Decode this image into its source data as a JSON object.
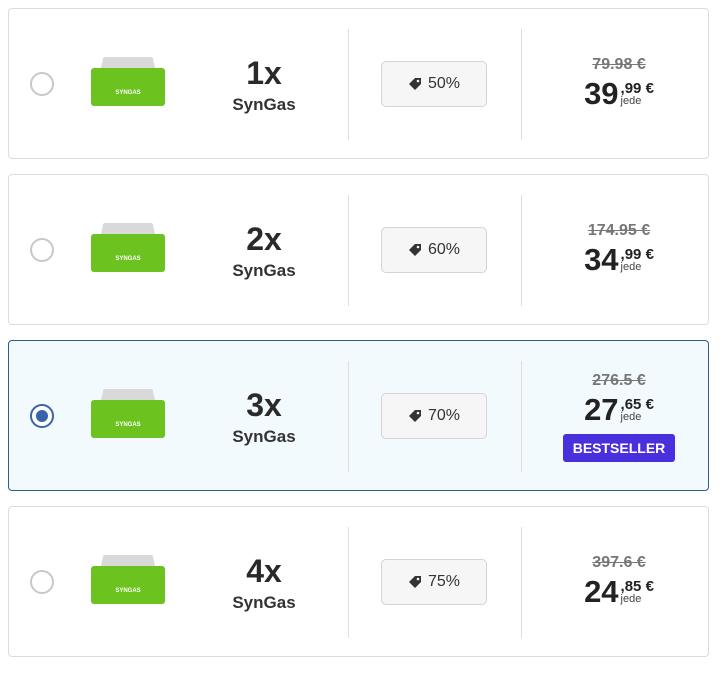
{
  "options": [
    {
      "quantity": "1x",
      "product": "SynGas",
      "device_label": "SYNGAS",
      "discount": "50%",
      "old_price": "79.98 €",
      "price_whole": "39",
      "price_fraction": ",99",
      "currency": "€",
      "per_unit": "jede",
      "badge": "",
      "selected": false
    },
    {
      "quantity": "2x",
      "product": "SynGas",
      "device_label": "SYNGAS",
      "discount": "60%",
      "old_price": "174.95 €",
      "price_whole": "34",
      "price_fraction": ",99",
      "currency": "€",
      "per_unit": "jede",
      "badge": "",
      "selected": false
    },
    {
      "quantity": "3x",
      "product": "SynGas",
      "device_label": "SYNGAS",
      "discount": "70%",
      "old_price": "276.5 €",
      "price_whole": "27",
      "price_fraction": ",65",
      "currency": "€",
      "per_unit": "jede",
      "badge": "BESTSELLER",
      "selected": true
    },
    {
      "quantity": "4x",
      "product": "SynGas",
      "device_label": "SYNGAS",
      "discount": "75%",
      "old_price": "397.6 €",
      "price_whole": "24",
      "price_fraction": ",85",
      "currency": "€",
      "per_unit": "jede",
      "badge": "",
      "selected": false
    }
  ],
  "colors": {
    "accent": "#3a62a8",
    "badge": "#4a2fdc",
    "device": "#6cc21f",
    "selected_bg": "#f3fafe"
  },
  "icons": {
    "discount": "price-tag-icon"
  }
}
